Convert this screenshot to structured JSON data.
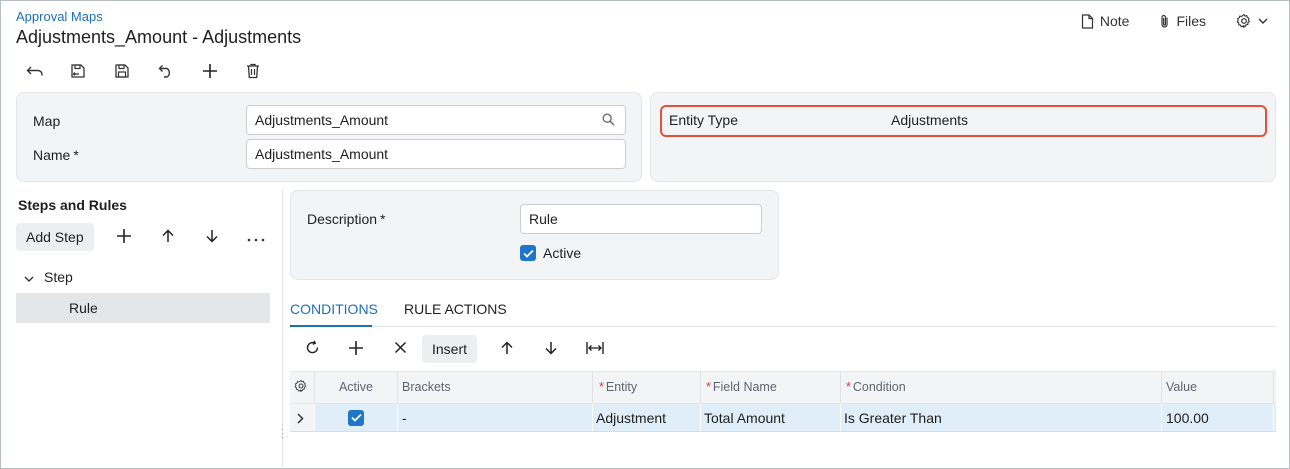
{
  "header": {
    "breadcrumb": "Approval Maps",
    "title": "Adjustments_Amount - Adjustments",
    "actions": [
      {
        "label": "Note",
        "icon": "note-icon"
      },
      {
        "label": "Files",
        "icon": "paperclip-icon"
      },
      {
        "label": "",
        "icon": "gear-icon"
      }
    ]
  },
  "toolbar": {
    "icons": [
      "undo-back-icon",
      "save-and-close-icon",
      "save-icon",
      "cancel-icon",
      "add-icon",
      "delete-icon"
    ]
  },
  "summary": {
    "map_label": "Map",
    "map_value": "Adjustments_Amount",
    "name_label": "Name",
    "name_value": "Adjustments_Amount",
    "required_mark": "*",
    "entity_type_label": "Entity Type",
    "entity_type_value": "Adjustments"
  },
  "steps": {
    "title": "Steps and Rules",
    "add_step_label": "Add Step",
    "tree": {
      "step_label": "Step",
      "rule_label": "Rule"
    }
  },
  "rule": {
    "description_label": "Description",
    "description_value": "Rule",
    "active_label": "Active",
    "active_checked": true
  },
  "tabs": [
    {
      "label": "CONDITIONS",
      "active": true
    },
    {
      "label": "RULE ACTIONS",
      "active": false
    }
  ],
  "grid_toolbar": {
    "insert_label": "Insert"
  },
  "grid": {
    "columns": [
      {
        "label": "Active",
        "required": false
      },
      {
        "label": "Brackets",
        "required": false
      },
      {
        "label": "Entity",
        "required": true
      },
      {
        "label": "Field Name",
        "required": true
      },
      {
        "label": "Condition",
        "required": true
      },
      {
        "label": "Value",
        "required": false
      }
    ],
    "rows": [
      {
        "active": true,
        "brackets": "-",
        "entity": "Adjustment",
        "field_name": "Total Amount",
        "condition": "Is Greater Than",
        "value": "100.00"
      }
    ]
  },
  "colors": {
    "accent": "#1d6fb8",
    "highlight_border": "#e2533a",
    "selected_row": "#dfeef8"
  }
}
